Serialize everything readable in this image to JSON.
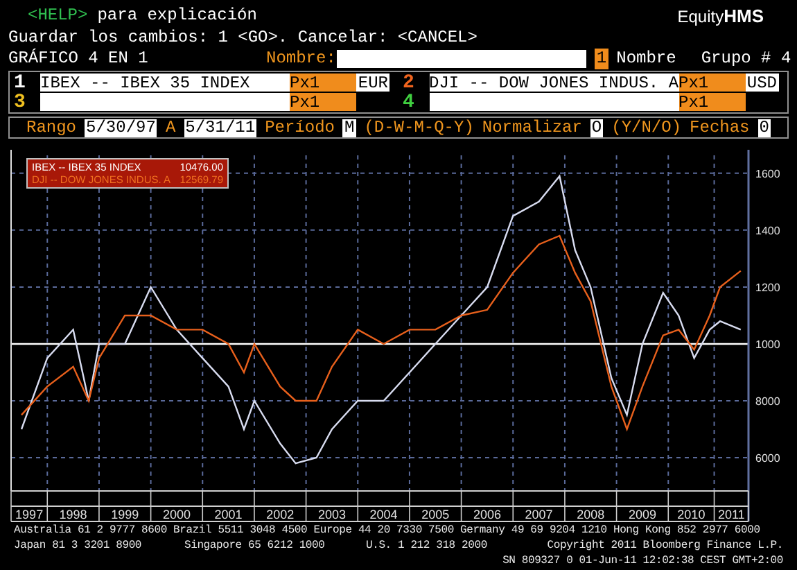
{
  "header": {
    "help_key": "<HELP>",
    "help_text": "para explicación",
    "brand_prefix": "Equity",
    "brand_suffix": "HMS"
  },
  "instructions": "Guardar los cambios: 1 <GO>. Cancelar: <CANCEL>",
  "title_row": {
    "title": "GRÁFICO 4 EN 1",
    "name_label": "Nombre:",
    "group_index": "1",
    "group_label": "Nombre",
    "group_number": "Grupo # 4"
  },
  "securities": [
    {
      "number": "1",
      "color": "#ffffff",
      "ticker": "IBEX -- IBEX 35 INDEX",
      "price_label": "Px",
      "multiplier": "1",
      "currency": "EUR"
    },
    {
      "number": "2",
      "color": "#f0641e",
      "ticker": "DJI -- DOW JONES INDUS. A",
      "price_label": "Px",
      "multiplier": "1",
      "currency": "USD"
    },
    {
      "number": "3",
      "color": "#f0c020",
      "price_label": "Px",
      "multiplier": "1"
    },
    {
      "number": "4",
      "color": "#40d040",
      "price_label": "Px",
      "multiplier": "1"
    }
  ],
  "range_bar": [
    {
      "kind": "label",
      "text": "Rango"
    },
    {
      "kind": "field",
      "text": "5/30/97"
    },
    {
      "kind": "label",
      "text": "A"
    },
    {
      "kind": "field",
      "text": "5/31/11"
    },
    {
      "kind": "label",
      "text": "Período"
    },
    {
      "kind": "field",
      "text": "M"
    },
    {
      "kind": "label",
      "text": "(D-W-M-Q-Y)"
    },
    {
      "kind": "label",
      "text": "Normalizar"
    },
    {
      "kind": "field",
      "text": "O"
    },
    {
      "kind": "label",
      "text": "(Y/N/O)"
    },
    {
      "kind": "label",
      "text": "Fechas"
    },
    {
      "kind": "field",
      "text": "0"
    }
  ],
  "chart": {
    "last_values": [
      "10476.00",
      "12569.79"
    ],
    "clipped_ytick_labels": [
      "1600",
      "1400",
      "1200",
      "1000"
    ],
    "chart_data": {
      "type": "line",
      "grid": true,
      "xlim": [
        1997.3,
        2011.55
      ],
      "ylim": [
        4830,
        16630
      ],
      "x": [
        1997.5,
        1998.0,
        1998.5,
        1998.8,
        1999.0,
        1999.5,
        2000.0,
        2000.5,
        2001.0,
        2001.5,
        2001.8,
        2002.0,
        2002.5,
        2002.8,
        2003.2,
        2003.5,
        2004.0,
        2004.5,
        2005.0,
        2005.5,
        2006.0,
        2006.5,
        2007.0,
        2007.5,
        2007.9,
        2008.2,
        2008.5,
        2008.9,
        2009.2,
        2009.5,
        2009.9,
        2010.2,
        2010.5,
        2010.8,
        2011.0,
        2011.4
      ],
      "series": [
        {
          "name": "IBEX -- IBEX 35 INDEX",
          "color": "#d8dcf0",
          "values": [
            7000,
            9500,
            10500,
            8000,
            10000,
            10000,
            12000,
            10500,
            9500,
            8500,
            7000,
            8000,
            6500,
            5800,
            6000,
            7000,
            8000,
            8000,
            9000,
            10000,
            11000,
            12000,
            14500,
            15000,
            15900,
            13300,
            12000,
            8800,
            7500,
            10000,
            11800,
            11000,
            9500,
            10500,
            10800,
            10500
          ]
        },
        {
          "name": "DJI -- DOW JONES INDUS. A",
          "color": "#e8601c",
          "values": [
            7500,
            8500,
            9200,
            8000,
            9500,
            11000,
            11000,
            10500,
            10500,
            10000,
            9000,
            10000,
            8500,
            8000,
            8000,
            9200,
            10500,
            10000,
            10500,
            10500,
            11000,
            11200,
            12500,
            13500,
            13800,
            12500,
            11500,
            8500,
            7000,
            8500,
            10300,
            10500,
            9800,
            11000,
            12000,
            12570
          ]
        }
      ],
      "xticks": [
        {
          "value": 1997.5,
          "label": "1997"
        },
        {
          "value": 1998.5,
          "label": "1998"
        },
        {
          "value": 1999.5,
          "label": "1999"
        },
        {
          "value": 2000.5,
          "label": "2000"
        },
        {
          "value": 2001.5,
          "label": "2001"
        },
        {
          "value": 2002.5,
          "label": "2002"
        },
        {
          "value": 2003.5,
          "label": "2003"
        },
        {
          "value": 2004.5,
          "label": "2004"
        },
        {
          "value": 2005.5,
          "label": "2005"
        },
        {
          "value": 2006.5,
          "label": "2006"
        },
        {
          "value": 2007.5,
          "label": "2007"
        },
        {
          "value": 2008.5,
          "label": "2008"
        },
        {
          "value": 2009.5,
          "label": "2009"
        },
        {
          "value": 2010.5,
          "label": "2010"
        },
        {
          "value": 2011.275,
          "label": "2011"
        }
      ],
      "yticks": [
        6000,
        8000
      ],
      "ref_lines": [
        {
          "axis": "y",
          "value": 10000
        }
      ]
    }
  },
  "footer": {
    "offices": "Australia 61 2 9777 8600 Brazil 5511 3048 4500 Europe 44 20 7330 7500 Germany 49 69 9204 1210 Hong Kong 852 2977 6000",
    "offices_2": [
      "Japan 81 3 3201 8900",
      "Singapore 65 6212 1000",
      "U.S. 1 212 318 2000",
      "Copyright 2011 Bloomberg Finance L.P."
    ],
    "session": "SN 809327 0 01-Jun-11 12:02:38 CEST GMT+2:00"
  }
}
